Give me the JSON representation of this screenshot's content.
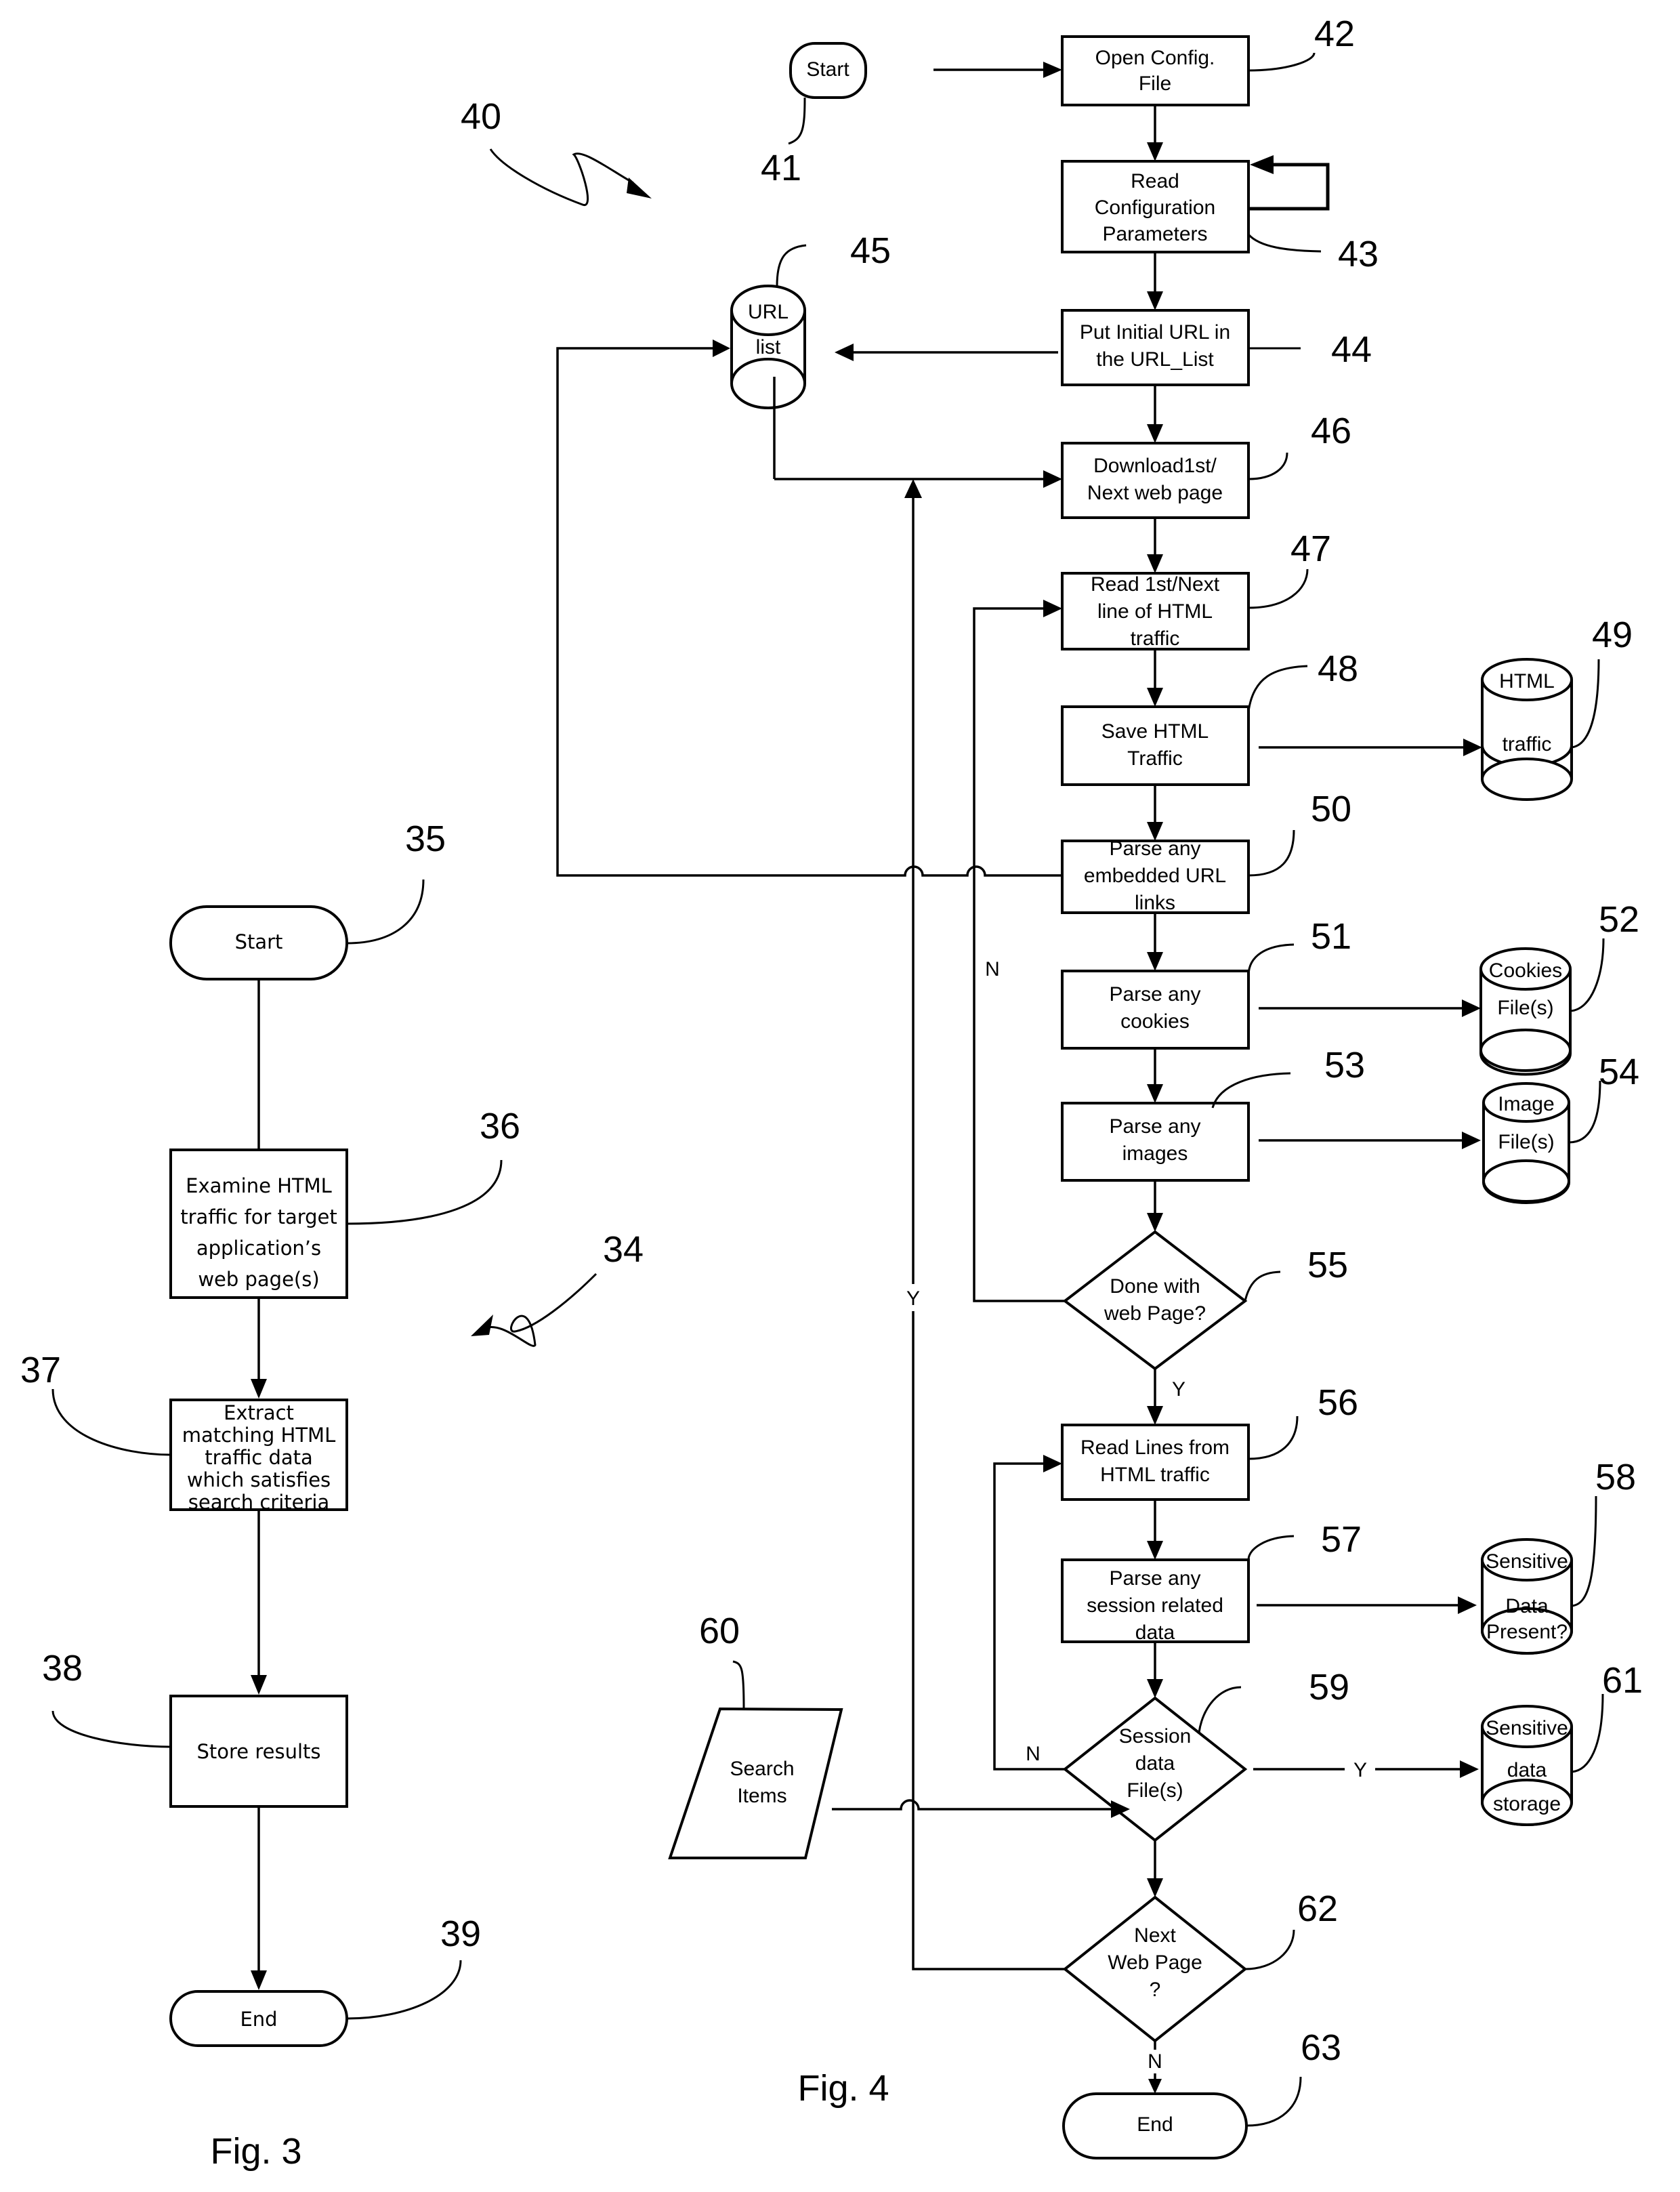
{
  "figures": {
    "fig3": {
      "caption": "Fig. 3",
      "reference": "34",
      "nodes": [
        {
          "id": "35",
          "type": "terminal",
          "lines": [
            "Start"
          ]
        },
        {
          "id": "36",
          "type": "process",
          "lines": [
            "Examine HTML",
            "traffic for target",
            "application’s",
            "web page(s)"
          ]
        },
        {
          "id": "37",
          "type": "process",
          "lines": [
            "Extract",
            "matching HTML",
            "traffic data",
            "which satisfies",
            "search criteria"
          ]
        },
        {
          "id": "38",
          "type": "process",
          "lines": [
            "Store results"
          ]
        },
        {
          "id": "39",
          "type": "terminal",
          "lines": [
            "End"
          ]
        }
      ]
    },
    "fig4": {
      "caption": "Fig. 4",
      "reference": "40",
      "nodes": [
        {
          "id": "41",
          "type": "terminal",
          "lines": [
            "Start"
          ]
        },
        {
          "id": "42",
          "type": "process",
          "lines": [
            "Open Config.",
            "File"
          ]
        },
        {
          "id": "43",
          "type": "process",
          "lines": [
            "Read",
            "Configuration",
            "Parameters"
          ]
        },
        {
          "id": "44",
          "type": "process",
          "lines": [
            "Put Initial URL in",
            "the URL_List"
          ]
        },
        {
          "id": "45",
          "type": "datastore",
          "lines": [
            "URL",
            "list"
          ]
        },
        {
          "id": "46",
          "type": "process",
          "lines": [
            "Download1st/",
            "Next web page"
          ]
        },
        {
          "id": "47",
          "type": "process",
          "lines": [
            "Read 1st/Next",
            "line of HTML",
            "traffic"
          ]
        },
        {
          "id": "48",
          "type": "process",
          "lines": [
            "Save HTML",
            "Traffic"
          ]
        },
        {
          "id": "49",
          "type": "datastore",
          "lines": [
            "HTML",
            "traffic"
          ]
        },
        {
          "id": "50",
          "type": "process",
          "lines": [
            "Parse any",
            "embedded URL",
            "links"
          ]
        },
        {
          "id": "51",
          "type": "process",
          "lines": [
            "Parse any",
            "cookies"
          ]
        },
        {
          "id": "52",
          "type": "datastore",
          "lines": [
            "Cookies",
            "File(s)"
          ]
        },
        {
          "id": "53",
          "type": "process",
          "lines": [
            "Parse any",
            "images"
          ]
        },
        {
          "id": "54",
          "type": "datastore",
          "lines": [
            "Image",
            "File(s)"
          ]
        },
        {
          "id": "55",
          "type": "decision",
          "lines": [
            "Done with",
            "web Page?"
          ]
        },
        {
          "id": "56",
          "type": "process",
          "lines": [
            "Read Lines from",
            "HTML traffic"
          ]
        },
        {
          "id": "57",
          "type": "process",
          "lines": [
            "Parse any",
            "session related",
            "data"
          ]
        },
        {
          "id": "58",
          "type": "decision",
          "lines": [
            "Sensitive",
            "Data",
            "Present?"
          ]
        },
        {
          "id": "59",
          "type": "datastore",
          "lines": [
            "Session",
            "data",
            "File(s)"
          ]
        },
        {
          "id": "60",
          "type": "input",
          "lines": [
            "Search",
            "Items"
          ]
        },
        {
          "id": "61",
          "type": "datastore",
          "lines": [
            "Sensitive",
            "data",
            "storage"
          ]
        },
        {
          "id": "62",
          "type": "decision",
          "lines": [
            "Next",
            "Web Page",
            "?"
          ]
        },
        {
          "id": "63",
          "type": "terminal",
          "lines": [
            "End"
          ]
        }
      ],
      "branch_labels": {
        "done_no": "N",
        "done_yes": "Y",
        "sensitive_no": "N",
        "sensitive_yes": "Y",
        "next_yes": "Y",
        "next_no": "N"
      }
    }
  }
}
